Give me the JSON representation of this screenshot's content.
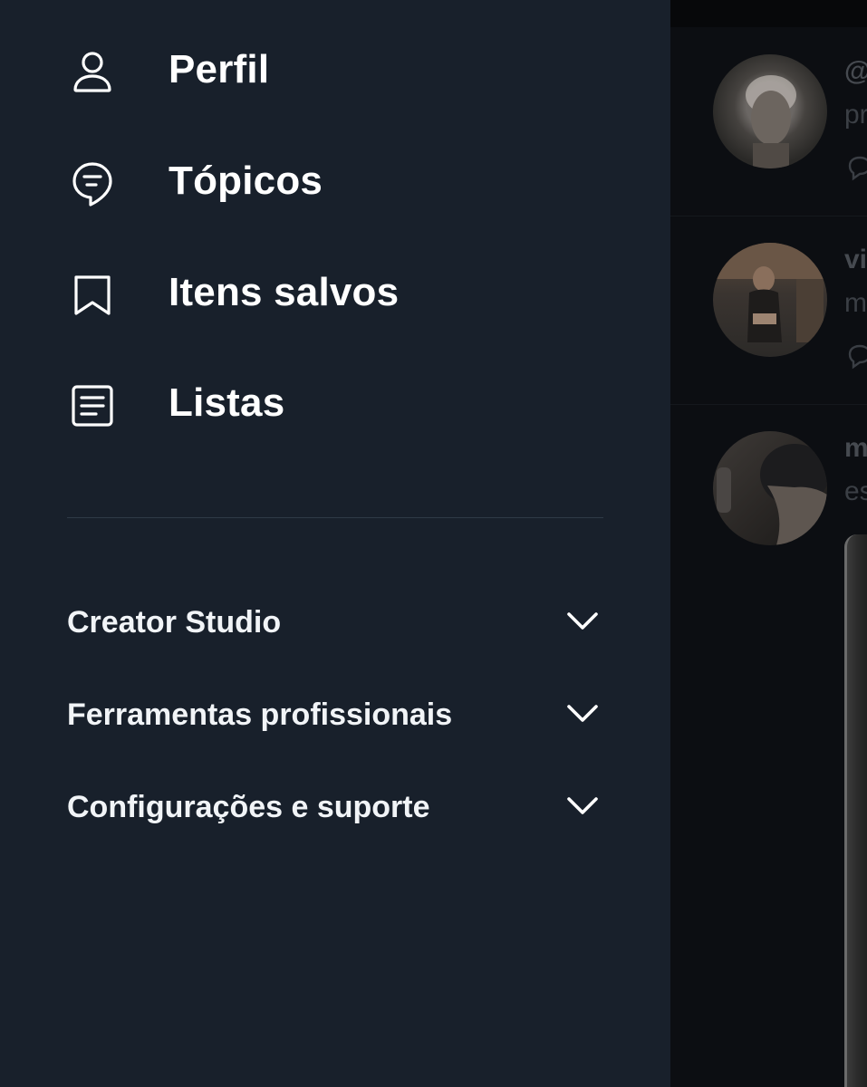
{
  "drawer": {
    "nav_items": [
      {
        "label": "Perfil",
        "icon": "person-icon"
      },
      {
        "label": "Tópicos",
        "icon": "topics-icon"
      },
      {
        "label": "Itens salvos",
        "icon": "bookmark-icon"
      },
      {
        "label": "Listas",
        "icon": "lists-icon"
      }
    ],
    "sections": [
      {
        "label": "Creator Studio",
        "icon": "chevron-down-icon"
      },
      {
        "label": "Ferramentas profissionais",
        "icon": "chevron-down-icon"
      },
      {
        "label": "Configurações e suporte",
        "icon": "chevron-down-icon"
      }
    ]
  },
  "feed": {
    "tweets": [
      {
        "line1": "@",
        "line2": "pr"
      },
      {
        "line1": "vi",
        "line2": "m"
      },
      {
        "line1": "m",
        "line2": "es"
      }
    ]
  },
  "colors": {
    "drawer_bg": "#18202b",
    "text": "#ffffff",
    "divider": "#2f3a46",
    "feed_bg": "#0c0e12"
  }
}
